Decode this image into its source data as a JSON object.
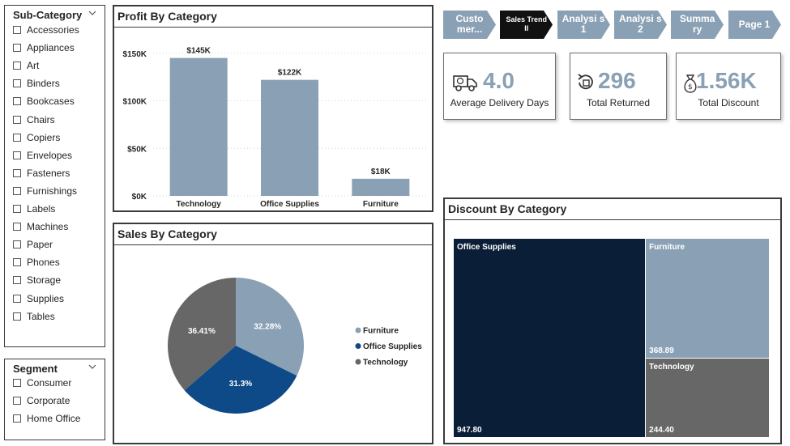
{
  "subcategory_slicer": {
    "title": "Sub-Category",
    "items": [
      "Accessories",
      "Appliances",
      "Art",
      "Binders",
      "Bookcases",
      "Chairs",
      "Copiers",
      "Envelopes",
      "Fasteners",
      "Furnishings",
      "Labels",
      "Machines",
      "Paper",
      "Phones",
      "Storage",
      "Supplies",
      "Tables"
    ]
  },
  "segment_slicer": {
    "title": "Segment",
    "items": [
      "Consumer",
      "Corporate",
      "Home Office"
    ]
  },
  "nav": [
    {
      "label": "Custo mer...",
      "active": false
    },
    {
      "label": "Sales Trend II",
      "active": true
    },
    {
      "label": "Analysi s 1",
      "active": false
    },
    {
      "label": "Analysi s 2",
      "active": false
    },
    {
      "label": "Summa ry",
      "active": false
    },
    {
      "label": "Page 1",
      "active": false
    }
  ],
  "kpis": [
    {
      "value": "4.0",
      "label": "Average Delivery Days",
      "icon": "delivery-truck-icon"
    },
    {
      "value": "296",
      "label": "Total Returned",
      "icon": "return-box-icon"
    },
    {
      "value": "1.56K",
      "label": "Total Discount",
      "icon": "money-bag-icon"
    }
  ],
  "colors": {
    "bar": "#8aa0b4",
    "furniture": "#8aa0b4",
    "office_supplies": "#0d4a87",
    "technology": "#676767",
    "treemap_office": "#0b1e37",
    "nav_inactive": "#8aa0b4",
    "nav_active": "#111111"
  },
  "chart_data": [
    {
      "type": "bar",
      "title": "Profit By Category",
      "categories": [
        "Technology",
        "Office Supplies",
        "Furniture"
      ],
      "values": [
        145,
        122,
        18
      ],
      "value_labels": [
        "$145K",
        "$122K",
        "$18K"
      ],
      "yticks": [
        "$0K",
        "$50K",
        "$100K",
        "$150K"
      ],
      "ylim": [
        0,
        160
      ]
    },
    {
      "type": "pie",
      "title": "Sales By Category",
      "categories": [
        "Furniture",
        "Office Supplies",
        "Technology"
      ],
      "values": [
        32.28,
        31.3,
        36.41
      ],
      "value_labels": [
        "32.28%",
        "31.3%",
        "36.41%"
      ],
      "legend": [
        "Furniture",
        "Office Supplies",
        "Technology"
      ],
      "legend_position": "right"
    },
    {
      "type": "treemap",
      "title": "Discount By Category",
      "categories": [
        "Office Supplies",
        "Furniture",
        "Technology"
      ],
      "values": [
        947.8,
        368.89,
        244.4
      ],
      "value_labels": [
        "947.80",
        "368.89",
        "244.40"
      ]
    }
  ]
}
